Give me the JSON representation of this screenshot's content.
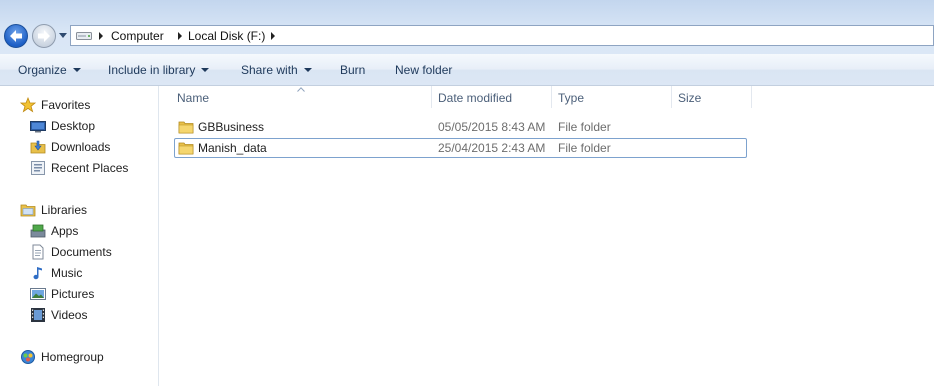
{
  "address": {
    "crumbs": [
      "Computer",
      "Local Disk (F:)"
    ]
  },
  "toolbar": {
    "organize": "Organize",
    "include_library": "Include in library",
    "share_with": "Share with",
    "burn": "Burn",
    "new_folder": "New folder"
  },
  "nav": {
    "favorites": "Favorites",
    "desktop": "Desktop",
    "downloads": "Downloads",
    "recent_places": "Recent Places",
    "libraries": "Libraries",
    "apps": "Apps",
    "documents": "Documents",
    "music": "Music",
    "pictures": "Pictures",
    "videos": "Videos",
    "homegroup": "Homegroup"
  },
  "columns": {
    "name": "Name",
    "date_modified": "Date modified",
    "type": "Type",
    "size": "Size"
  },
  "files": [
    {
      "name": "GBBusiness",
      "date": "05/05/2015 8:43 AM",
      "type": "File folder",
      "size": ""
    },
    {
      "name": "Manish_data",
      "date": "25/04/2015 2:43 AM",
      "type": "File folder",
      "size": ""
    }
  ],
  "colors": {
    "accent_blue": "#1d5fc6",
    "folder_yellow": "#e8c04a",
    "selection_border": "#7da2ce"
  }
}
